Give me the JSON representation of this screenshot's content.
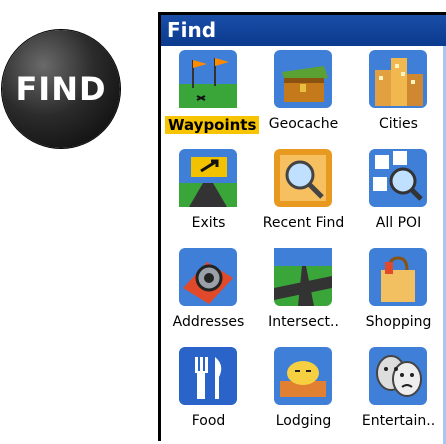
{
  "badge": {
    "text": "FIND"
  },
  "window": {
    "title": "Find"
  },
  "items": [
    {
      "label": "Waypoints",
      "selected": true,
      "icon": "waypoint-flags-icon"
    },
    {
      "label": "Geocache",
      "selected": false,
      "icon": "treasure-chest-icon"
    },
    {
      "label": "Cities",
      "selected": false,
      "icon": "city-buildings-icon"
    },
    {
      "label": "Exits",
      "selected": false,
      "icon": "highway-exit-icon"
    },
    {
      "label": "Recent Find",
      "selected": false,
      "icon": "recent-find-magnifier-icon"
    },
    {
      "label": "All POI",
      "selected": false,
      "icon": "all-poi-magnifier-icon"
    },
    {
      "label": "Addresses",
      "selected": false,
      "icon": "address-pin-icon"
    },
    {
      "label": "Intersect..",
      "selected": false,
      "icon": "intersection-road-icon"
    },
    {
      "label": "Shopping",
      "selected": false,
      "icon": "shopping-bag-icon"
    },
    {
      "label": "Food",
      "selected": false,
      "icon": "fork-knife-icon"
    },
    {
      "label": "Lodging",
      "selected": false,
      "icon": "lodging-sleep-icon"
    },
    {
      "label": "Entertain..",
      "selected": false,
      "icon": "theater-masks-icon"
    }
  ],
  "colors": {
    "title_bar": "#0b3a8e",
    "selection": "#f6c400"
  }
}
